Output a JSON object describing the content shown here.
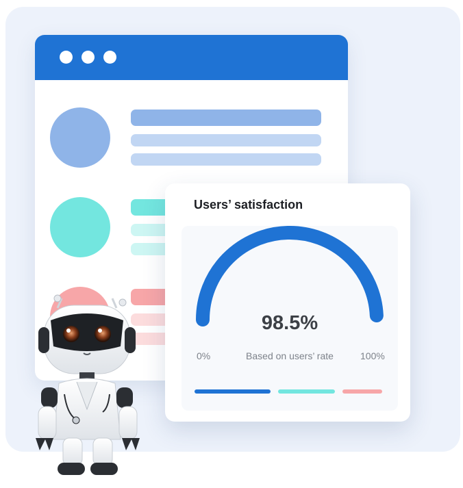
{
  "colors": {
    "accent": "#1f73d4",
    "teal": "#73e6df",
    "pink": "#f7a6a8",
    "track": "#e4e8ef"
  },
  "card": {
    "title": "Users’ satisfaction"
  },
  "gauge": {
    "value_label": "98.5%",
    "value_fraction": 0.985,
    "min_label": "0%",
    "max_label": "100%",
    "caption": "Based on users’ rate"
  },
  "icons": {
    "robot": "robot-mascot-icon"
  }
}
